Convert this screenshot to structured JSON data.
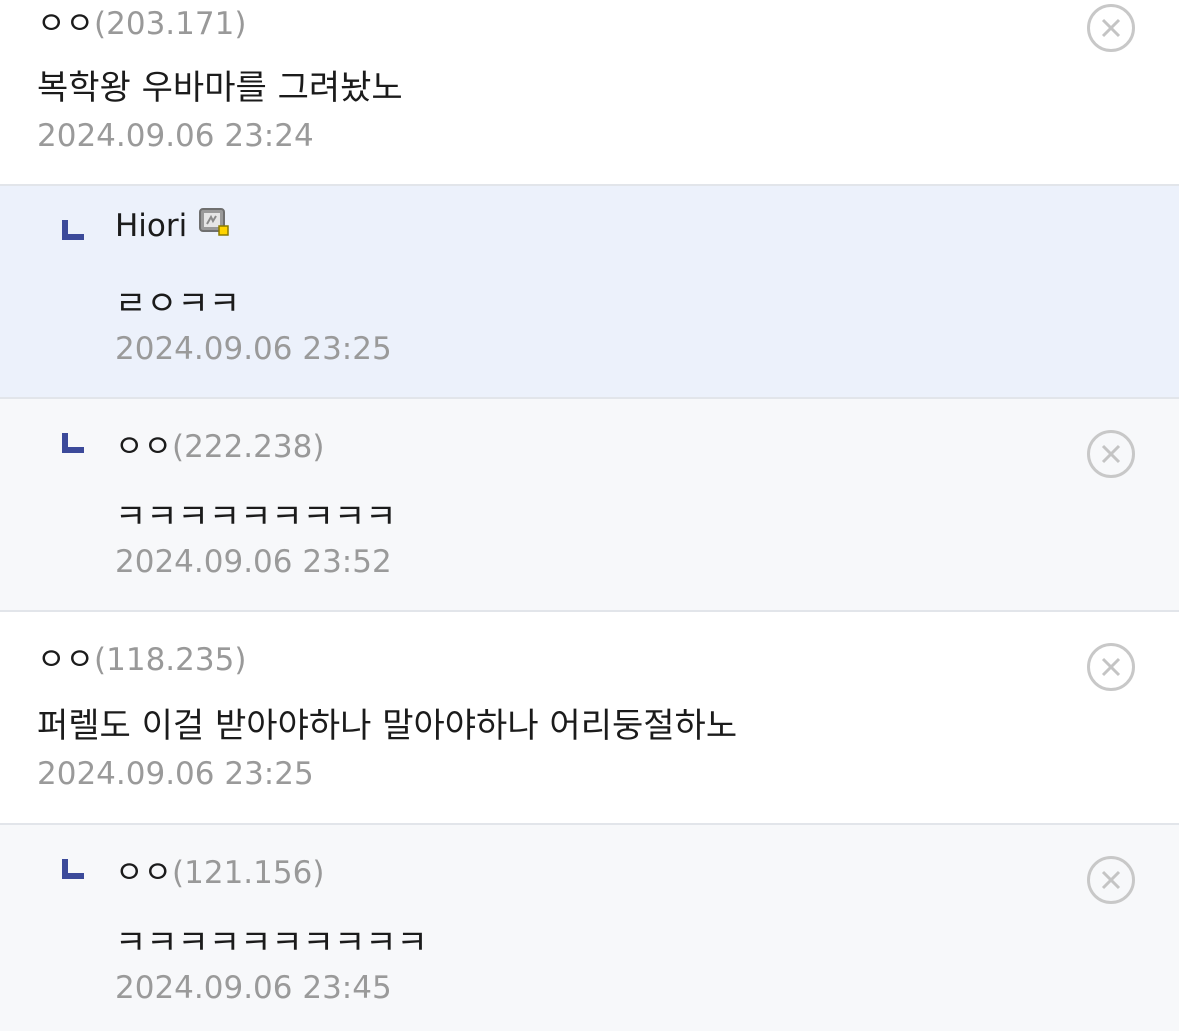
{
  "comments": [
    {
      "nickname": "ㅇㅇ",
      "ip": "(203.171)",
      "text": "복학왕 우바마를 그려놨노",
      "time": "2024.09.06 23:24",
      "is_reply": false
    },
    {
      "nickname": "Hiori",
      "ip": "",
      "text": "ㄹㅇㅋㅋ",
      "time": "2024.09.06 23:25",
      "is_reply": true,
      "is_writer": true,
      "badge_icon": "gallog-icon"
    },
    {
      "nickname": "ㅇㅇ",
      "ip": "(222.238)",
      "text": "ㅋㅋㅋㅋㅋㅋㅋㅋㅋ",
      "time": "2024.09.06 23:52",
      "is_reply": true
    },
    {
      "nickname": "ㅇㅇ",
      "ip": "(118.235)",
      "text": "퍼렐도 이걸 받아야하나 말아야하나 어리둥절하노",
      "time": "2024.09.06 23:25",
      "is_reply": false
    },
    {
      "nickname": "ㅇㅇ",
      "ip": "(121.156)",
      "text": "ㅋㅋㅋㅋㅋㅋㅋㅋㅋㅋ",
      "time": "2024.09.06 23:45",
      "is_reply": true
    }
  ],
  "icons": {
    "reply": "reply-arrow-icon",
    "delete": "delete-x-icon"
  },
  "colors": {
    "reply_mark": "#3c4a9a",
    "writer_reply_bg": "#ecf1fb",
    "reply_bg": "#f7f8fa",
    "meta_gray": "#999999"
  }
}
